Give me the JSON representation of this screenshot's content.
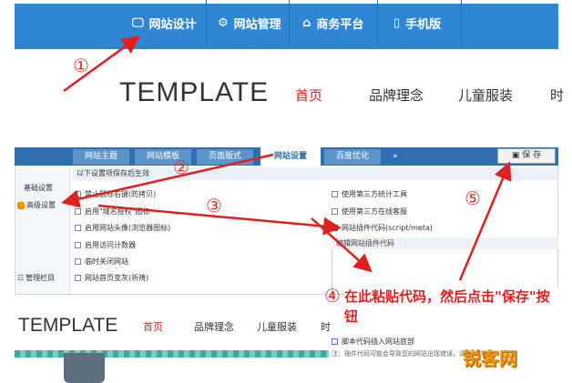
{
  "top_nav": {
    "items": [
      {
        "icon": "monitor-icon",
        "glyph": "🖵",
        "label": "网站设计"
      },
      {
        "icon": "gear-icon",
        "glyph": "⚙",
        "label": "网站管理"
      },
      {
        "icon": "home-icon",
        "glyph": "⌂",
        "label": "商务平台"
      },
      {
        "icon": "phone-icon",
        "glyph": "▯",
        "label": "手机版"
      }
    ],
    "background": "#2f87d3"
  },
  "site_header": {
    "logo": "TEMPLATE",
    "nav": [
      "首页",
      "品牌理念",
      "儿童服装",
      "时"
    ],
    "active_color": "#e02020"
  },
  "editor": {
    "tabs": [
      "网站主题",
      "网站模板",
      "页面版式",
      "网站设置",
      "百度优化",
      "«"
    ],
    "active_tab": "网站设置",
    "save_label": "保 存",
    "save_icon": "save-icon",
    "sidebar": [
      "基础设置",
      "高级设置",
      "管理栏目"
    ],
    "subheading": "以下设置项保存后生效",
    "left_options": [
      {
        "label": "禁止鼠标右键(防拷贝)",
        "checked": false
      },
      {
        "label": "启用\"域名授权\"图标",
        "checked": false
      },
      {
        "label": "启用网站头像(浏览器图标)",
        "checked": false
      },
      {
        "label": "启用访问计数器",
        "checked": false
      },
      {
        "label": "临时关闭网站",
        "checked": false
      },
      {
        "label": "网站首页变灰(祈祷)",
        "checked": false
      }
    ],
    "right_options": [
      {
        "label": "使用第三方统计工具",
        "checked": false
      },
      {
        "label": "使用第三方在线客服",
        "checked": false
      },
      {
        "label": "网站插件代码(script/meta)",
        "checked": true
      }
    ],
    "code_box_header": "编辑网站插件代码",
    "bottom_option": "脚本代码插入网站底部",
    "bottom_note": "注：插件代码可能会导致您的网站出现错误，请确认代码"
  },
  "site_header_2": {
    "logo": "TEMPLATE",
    "nav": [
      "首页",
      "品牌理念",
      "儿童服装",
      "时"
    ]
  },
  "annotations": {
    "steps": [
      "①",
      "②",
      "③",
      "④",
      "⑤"
    ],
    "instruction": "在此粘贴代码，然后点击\"保存\"按钮",
    "color": "#e02020"
  },
  "watermark": "锐客网"
}
